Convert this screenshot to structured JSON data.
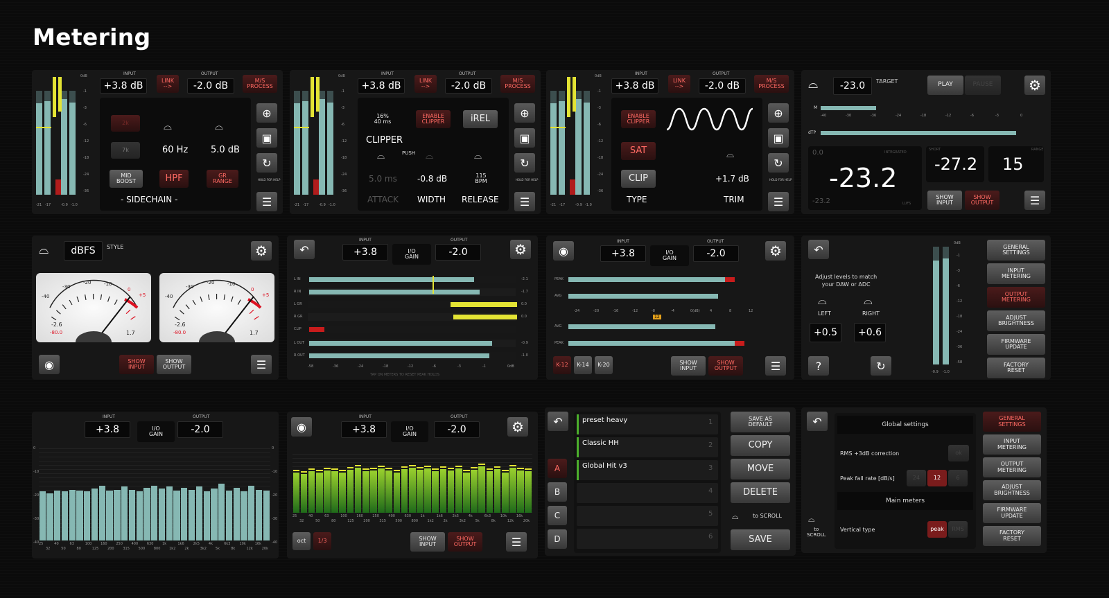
{
  "page": {
    "title": "Metering"
  },
  "common": {
    "input_label": "INPUT",
    "output_label": "OUTPUT",
    "input_db": "+3.8 dB",
    "output_db": "-2.0 dB",
    "input": "+3.8",
    "output": "-2.0",
    "link": "LINK\n-->",
    "ms": "M/S\nPROCESS",
    "io_gain": "I/O\nGAIN",
    "show_input": "SHOW\nINPUT",
    "show_output": "SHOW\nOUTPUT",
    "db": "0dB",
    "hold": "HOLD FOR HELP"
  },
  "scale": [
    "-1",
    "-3",
    "-6",
    "-12",
    "-18",
    "-24",
    "-36"
  ],
  "scale2": [
    "-1",
    "-3",
    "-6",
    "-12",
    "-18",
    "-24",
    "-36",
    "-58"
  ],
  "peaks": [
    "-21",
    "-17",
    "-0.9",
    "-1.0"
  ],
  "p1": {
    "b2k": "2k",
    "b7k": "7k",
    "freq": "60 Hz",
    "gr": "5.0 dB",
    "mid": "MID\nBOOST",
    "hpf": "HPF",
    "grrange": "GR\nRANGE",
    "sidechain": "- SIDECHAIN -"
  },
  "p2": {
    "knee": "16%\n40 ms",
    "enable": "ENABLE\nCLIPPER",
    "irel": "iREL",
    "clipper": "CLIPPER",
    "push": "PUSH",
    "attack_val": "5.0 ms",
    "width_val": "-0.8 dB",
    "bpm": "115\nBPM",
    "attack": "ATTACK",
    "width": "WIDTH",
    "release": "RELEASE"
  },
  "p3": {
    "enable": "ENABLE\nCLIPPER",
    "sat": "SAT",
    "clip": "CLIP",
    "type": "TYPE",
    "trim_val": "+1.7 dB",
    "trim": "TRIM"
  },
  "p4": {
    "target": "-23.0",
    "target_label": "TARGET",
    "play": "PLAY",
    "pause": "PAUSE",
    "m": "M",
    "dtp": "dTP",
    "integrated": "-23.2",
    "integrated_label": "INTEGRATED",
    "int_small": "0.0",
    "int_min": "-23.2",
    "lufs": "LUFS",
    "short": "-27.2",
    "short_label": "SHORT",
    "range": "15",
    "range_label": "RANGE",
    "ticks": [
      "-40",
      "-30",
      "-36",
      "-24",
      "-18",
      "-12",
      "-6",
      "-3",
      "0"
    ]
  },
  "p5": {
    "dbfs": "dBFS",
    "style": "STYLE",
    "vu_l_val": "-2.6",
    "vu_l_peak": "-80.0",
    "vu_l_r": "1.7",
    "vu_r_val": "-2.6",
    "vu_r_peak": "-80.0",
    "vu_r_r": "1.7",
    "vu_scale": [
      "-40",
      "-30",
      "-20",
      "-10",
      "0",
      "+5"
    ]
  },
  "p6": {
    "rows": [
      "L IN",
      "R IN",
      "L GR",
      "R GR",
      "CLIP",
      "L OUT",
      "R OUT"
    ],
    "vals": [
      "-2.1",
      "-1.7",
      "0.0",
      "0.0",
      "",
      "-0.9",
      "-1.0"
    ],
    "axis": [
      "-58",
      "-36",
      "-24",
      "-18",
      "-12",
      "-6",
      "-3",
      "-1",
      "0dB"
    ],
    "foot": "TAP ON METERS TO RESET PEAK HOLDS"
  },
  "p7": {
    "labels": [
      "PEAK",
      "",
      "AVG",
      "AVG",
      "",
      "PEAK"
    ],
    "axis": [
      "-24",
      "-20",
      "-16",
      "-12",
      "-8",
      "-4",
      "0(dB)",
      "4",
      "8",
      "12"
    ],
    "badge": "12",
    "k12": "K-12",
    "k14": "K-14",
    "k20": "K-20"
  },
  "p8": {
    "msg": "Adjust levels to match\nyour DAW or ADC",
    "left": "LEFT",
    "right": "RIGHT",
    "left_val": "+0.5",
    "right_val": "+0.6",
    "help": "?",
    "menu": [
      "GENERAL\nSETTINGS",
      "INPUT\nMETERING",
      "OUTPUT\nMETERING",
      "ADJUST\nBRIGHTNESS",
      "FIRMWARE\nUPDATE",
      "FACTORY\nRESET"
    ]
  },
  "p9": {
    "yaxis": [
      "0",
      "-10",
      "-20",
      "-30",
      "-40"
    ],
    "freqs": [
      "25",
      "40",
      "63",
      "100",
      "160",
      "250",
      "400",
      "630",
      "1k",
      "1k6",
      "2k5",
      "4k",
      "6k3",
      "10k",
      "16k"
    ],
    "freqs2": [
      "32",
      "50",
      "80",
      "125",
      "200",
      "315",
      "500",
      "800",
      "1k2",
      "2k",
      "3k2",
      "5k",
      "8k",
      "12k",
      "20k"
    ]
  },
  "p10": {
    "oct": "oct",
    "third": "1/3"
  },
  "p11": {
    "presets": [
      {
        "name": "preset heavy",
        "num": "1"
      },
      {
        "name": "Classic HH",
        "num": "2"
      },
      {
        "name": "Global Hit v3",
        "num": "3"
      },
      {
        "name": "",
        "num": "4"
      },
      {
        "name": "",
        "num": "5"
      },
      {
        "name": "",
        "num": "6"
      }
    ],
    "banks": [
      "A",
      "B",
      "C",
      "D"
    ],
    "save_default": "SAVE AS\nDEFAULT",
    "copy": "COPY",
    "move": "MOVE",
    "delete": "DELETE",
    "scroll": "to SCROLL",
    "save": "SAVE"
  },
  "p12": {
    "global": "Global settings",
    "rms": "RMS +3dB correction",
    "ok": "ok",
    "fall": "Peak fall rate [dB/s]",
    "fall_vals": [
      "24",
      "12",
      "6"
    ],
    "main": "Main meters",
    "vtype": "Vertical type",
    "peak": "peak",
    "rms_opt": "RMS",
    "to": "to\nSCROLL"
  },
  "colors": {
    "accent_red": "#ff6a63",
    "meter": "#86b8b3",
    "yellow": "#e3e334",
    "green": "#4caf2c"
  }
}
